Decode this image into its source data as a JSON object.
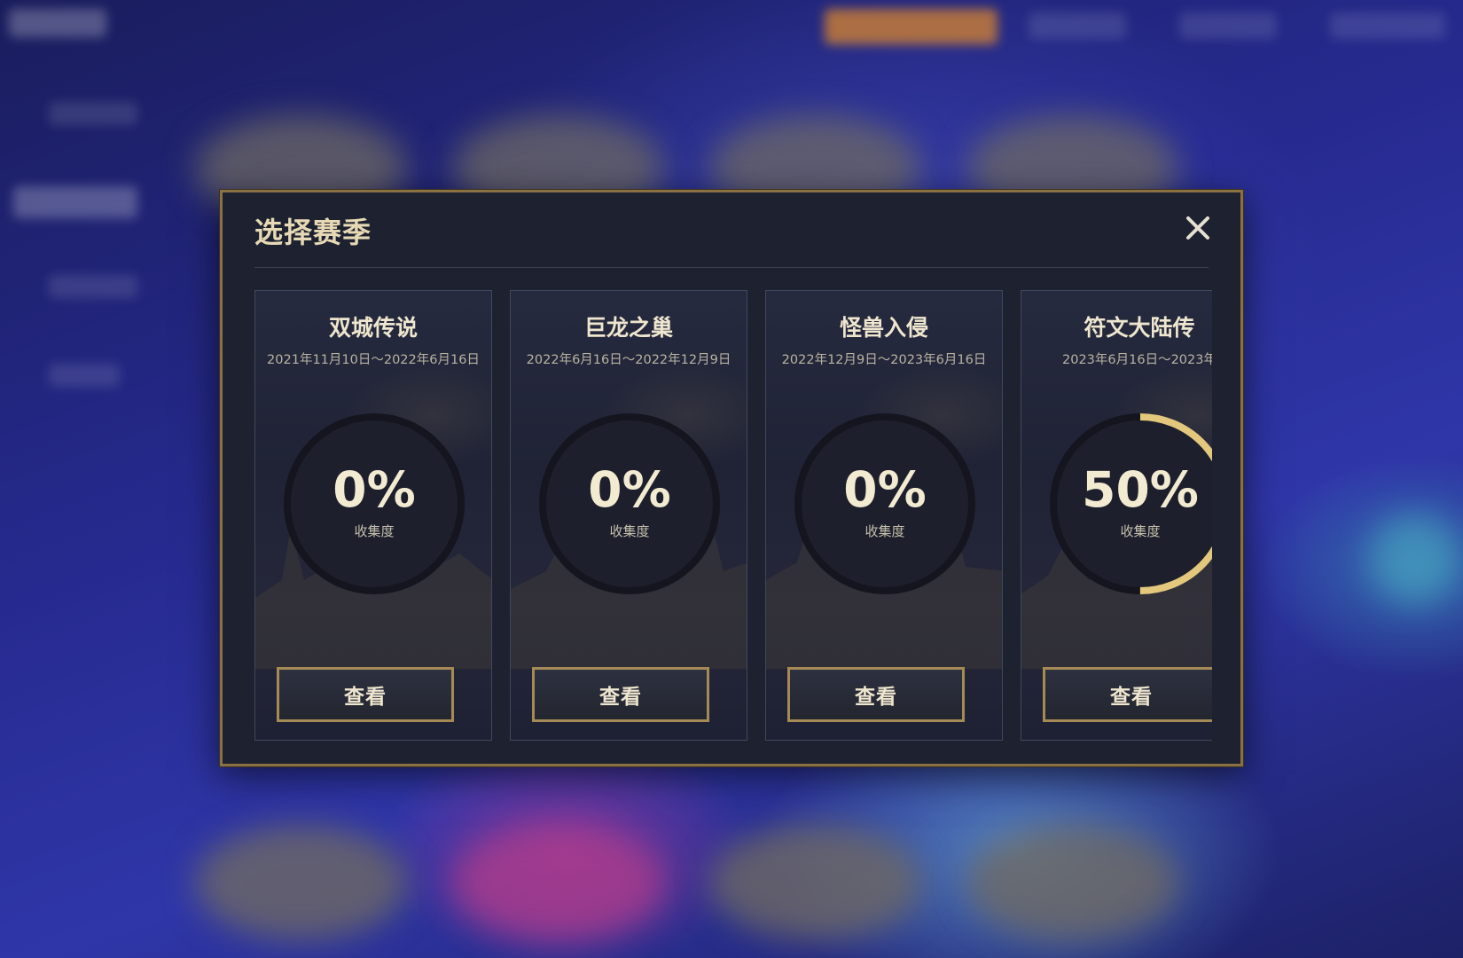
{
  "dialog": {
    "title": "选择赛季",
    "close_icon": "close-icon",
    "accent_color": "#a68a55",
    "progress_color": "#e3c77c"
  },
  "seasons": [
    {
      "name": "双城传说",
      "dates": "2021年11月10日～2022年6月16日",
      "percent_label": "0%",
      "progress": 0,
      "progress_label": "收集度",
      "button_label": "查看"
    },
    {
      "name": "巨龙之巢",
      "dates": "2022年6月16日～2022年12月9日",
      "percent_label": "0%",
      "progress": 0,
      "progress_label": "收集度",
      "button_label": "查看"
    },
    {
      "name": "怪兽入侵",
      "dates": "2022年12月9日～2023年6月16日",
      "percent_label": "0%",
      "progress": 0,
      "progress_label": "收集度",
      "button_label": "查看"
    },
    {
      "name": "符文大陆传",
      "dates": "2023年6月16日～2023年",
      "percent_label": "50%",
      "progress": 0.5,
      "progress_label": "收集度",
      "button_label": "查看"
    }
  ]
}
